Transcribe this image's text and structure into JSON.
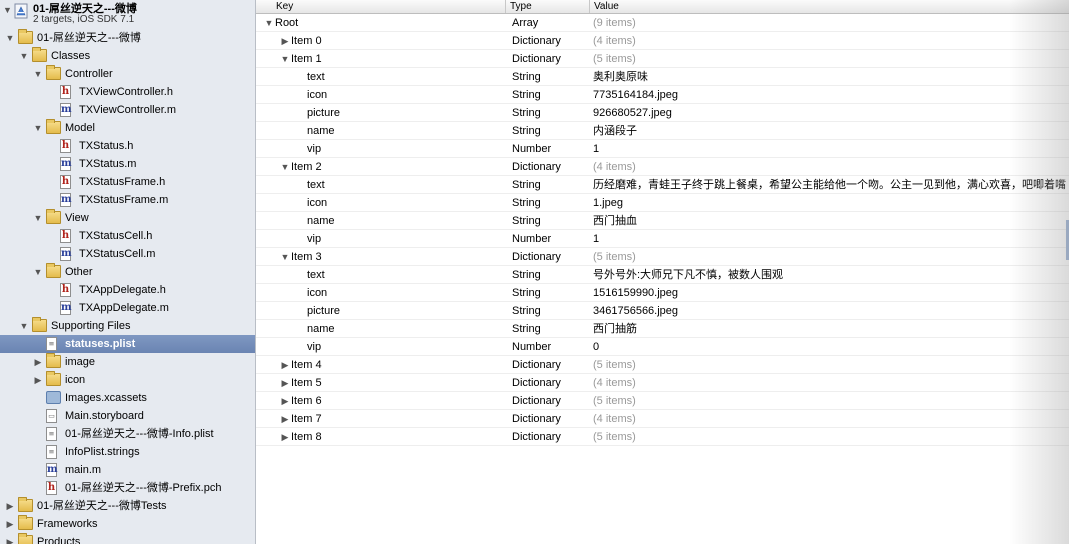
{
  "project": {
    "name": "01-屌丝逆天之---微博",
    "subtitle": "2 targets, iOS SDK 7.1",
    "disclosure": "▼"
  },
  "navigator": [
    {
      "depth": 1,
      "kind": "folder",
      "label": "01-屌丝逆天之---微博",
      "tri": "▼"
    },
    {
      "depth": 2,
      "kind": "folder",
      "label": "Classes",
      "tri": "▼"
    },
    {
      "depth": 3,
      "kind": "folder",
      "label": "Controller",
      "tri": "▼"
    },
    {
      "depth": 4,
      "kind": "h",
      "label": "TXViewController.h",
      "tri": ""
    },
    {
      "depth": 4,
      "kind": "m",
      "label": "TXViewController.m",
      "tri": ""
    },
    {
      "depth": 3,
      "kind": "folder",
      "label": "Model",
      "tri": "▼"
    },
    {
      "depth": 4,
      "kind": "h",
      "label": "TXStatus.h",
      "tri": ""
    },
    {
      "depth": 4,
      "kind": "m",
      "label": "TXStatus.m",
      "tri": ""
    },
    {
      "depth": 4,
      "kind": "h",
      "label": "TXStatusFrame.h",
      "tri": ""
    },
    {
      "depth": 4,
      "kind": "m",
      "label": "TXStatusFrame.m",
      "tri": ""
    },
    {
      "depth": 3,
      "kind": "folder",
      "label": "View",
      "tri": "▼"
    },
    {
      "depth": 4,
      "kind": "h",
      "label": "TXStatusCell.h",
      "tri": ""
    },
    {
      "depth": 4,
      "kind": "m",
      "label": "TXStatusCell.m",
      "tri": ""
    },
    {
      "depth": 3,
      "kind": "folder",
      "label": "Other",
      "tri": "▼"
    },
    {
      "depth": 4,
      "kind": "h",
      "label": "TXAppDelegate.h",
      "tri": ""
    },
    {
      "depth": 4,
      "kind": "m",
      "label": "TXAppDelegate.m",
      "tri": ""
    },
    {
      "depth": 2,
      "kind": "folder",
      "label": "Supporting Files",
      "tri": "▼"
    },
    {
      "depth": 3,
      "kind": "plain",
      "label": "statuses.plist",
      "tri": "",
      "selected": true
    },
    {
      "depth": 3,
      "kind": "folder",
      "label": "image",
      "tri": "▶"
    },
    {
      "depth": 3,
      "kind": "folder",
      "label": "icon",
      "tri": "▶"
    },
    {
      "depth": 3,
      "kind": "asset",
      "label": "Images.xcassets",
      "tri": ""
    },
    {
      "depth": 3,
      "kind": "sb",
      "label": "Main.storyboard",
      "tri": ""
    },
    {
      "depth": 3,
      "kind": "plain",
      "label": "01-屌丝逆天之---微博-Info.plist",
      "tri": ""
    },
    {
      "depth": 3,
      "kind": "plain",
      "label": "InfoPlist.strings",
      "tri": ""
    },
    {
      "depth": 3,
      "kind": "m",
      "label": "main.m",
      "tri": ""
    },
    {
      "depth": 3,
      "kind": "h",
      "label": "01-屌丝逆天之---微博-Prefix.pch",
      "tri": ""
    },
    {
      "depth": 1,
      "kind": "folder",
      "label": "01-屌丝逆天之---微博Tests",
      "tri": "▶"
    },
    {
      "depth": 1,
      "kind": "folder",
      "label": "Frameworks",
      "tri": "▶"
    },
    {
      "depth": 1,
      "kind": "folder",
      "label": "Products",
      "tri": "▶"
    }
  ],
  "plist": {
    "headers": {
      "key": "Key",
      "type": "Type",
      "value": "Value"
    },
    "rows": [
      {
        "depth": 0,
        "tri": "▼",
        "key": "Root",
        "type": "Array",
        "value": "(9 items)",
        "gray": true
      },
      {
        "depth": 1,
        "tri": "▶",
        "key": "Item 0",
        "type": "Dictionary",
        "value": "(4 items)",
        "gray": true
      },
      {
        "depth": 1,
        "tri": "▼",
        "key": "Item 1",
        "type": "Dictionary",
        "value": "(5 items)",
        "gray": true
      },
      {
        "depth": 2,
        "tri": "",
        "key": "text",
        "type": "String",
        "value": "奥利奥原味",
        "gray": false
      },
      {
        "depth": 2,
        "tri": "",
        "key": "icon",
        "type": "String",
        "value": "7735164184.jpeg",
        "gray": false
      },
      {
        "depth": 2,
        "tri": "",
        "key": "picture",
        "type": "String",
        "value": "926680527.jpeg",
        "gray": false
      },
      {
        "depth": 2,
        "tri": "",
        "key": "name",
        "type": "String",
        "value": "内涵段子",
        "gray": false
      },
      {
        "depth": 2,
        "tri": "",
        "key": "vip",
        "type": "Number",
        "value": "1",
        "gray": false
      },
      {
        "depth": 1,
        "tri": "▼",
        "key": "Item 2",
        "type": "Dictionary",
        "value": "(4 items)",
        "gray": true
      },
      {
        "depth": 2,
        "tri": "",
        "key": "text",
        "type": "String",
        "value": "历经磨难，青蛙王子终于跳上餐桌，希望公主能给他一个吻。公主一见到他，满心欢喜，吧唧着嘴",
        "gray": false
      },
      {
        "depth": 2,
        "tri": "",
        "key": "icon",
        "type": "String",
        "value": "1.jpeg",
        "gray": false
      },
      {
        "depth": 2,
        "tri": "",
        "key": "name",
        "type": "String",
        "value": "西门抽血",
        "gray": false
      },
      {
        "depth": 2,
        "tri": "",
        "key": "vip",
        "type": "Number",
        "value": "1",
        "gray": false
      },
      {
        "depth": 1,
        "tri": "▼",
        "key": "Item 3",
        "type": "Dictionary",
        "value": "(5 items)",
        "gray": true
      },
      {
        "depth": 2,
        "tri": "",
        "key": "text",
        "type": "String",
        "value": "号外号外:大师兄下凡不慎，被数人围观",
        "gray": false
      },
      {
        "depth": 2,
        "tri": "",
        "key": "icon",
        "type": "String",
        "value": "1516159990.jpeg",
        "gray": false
      },
      {
        "depth": 2,
        "tri": "",
        "key": "picture",
        "type": "String",
        "value": "3461756566.jpeg",
        "gray": false
      },
      {
        "depth": 2,
        "tri": "",
        "key": "name",
        "type": "String",
        "value": "西门抽筋",
        "gray": false
      },
      {
        "depth": 2,
        "tri": "",
        "key": "vip",
        "type": "Number",
        "value": "0",
        "gray": false
      },
      {
        "depth": 1,
        "tri": "▶",
        "key": "Item 4",
        "type": "Dictionary",
        "value": "(5 items)",
        "gray": true
      },
      {
        "depth": 1,
        "tri": "▶",
        "key": "Item 5",
        "type": "Dictionary",
        "value": "(4 items)",
        "gray": true
      },
      {
        "depth": 1,
        "tri": "▶",
        "key": "Item 6",
        "type": "Dictionary",
        "value": "(5 items)",
        "gray": true
      },
      {
        "depth": 1,
        "tri": "▶",
        "key": "Item 7",
        "type": "Dictionary",
        "value": "(4 items)",
        "gray": true
      },
      {
        "depth": 1,
        "tri": "▶",
        "key": "Item 8",
        "type": "Dictionary",
        "value": "(5 items)",
        "gray": true
      }
    ]
  }
}
